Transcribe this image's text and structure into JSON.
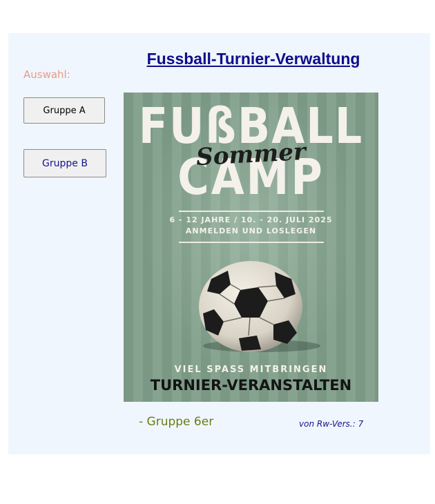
{
  "header": {
    "title": "Fussball-Turnier-Verwaltung"
  },
  "sidebar": {
    "label": "Auswahl:",
    "buttons": [
      {
        "label": "Gruppe A"
      },
      {
        "label": "Gruppe B"
      }
    ]
  },
  "poster": {
    "line1": "FUßBALL",
    "script": "Sommer",
    "line2": "CAMP",
    "dates": "6 - 12 JAHRE / 10. - 20. JULI 2025",
    "signup": "ANMELDEN UND LOSLEGEN",
    "fun": "VIEL SPASS MITBRINGEN",
    "event": "TURNIER-VERANSTALTEN",
    "icon": "soccer-ball-icon"
  },
  "footer": {
    "group": "- Gruppe 6er",
    "version": "von Rw-Vers.: 7"
  },
  "colors": {
    "panel_bg": "#f0f6fd",
    "title": "#0d0d8c",
    "auswahl": "#e79a87",
    "group": "#6b7c17",
    "poster_bg": "#7a9884"
  }
}
